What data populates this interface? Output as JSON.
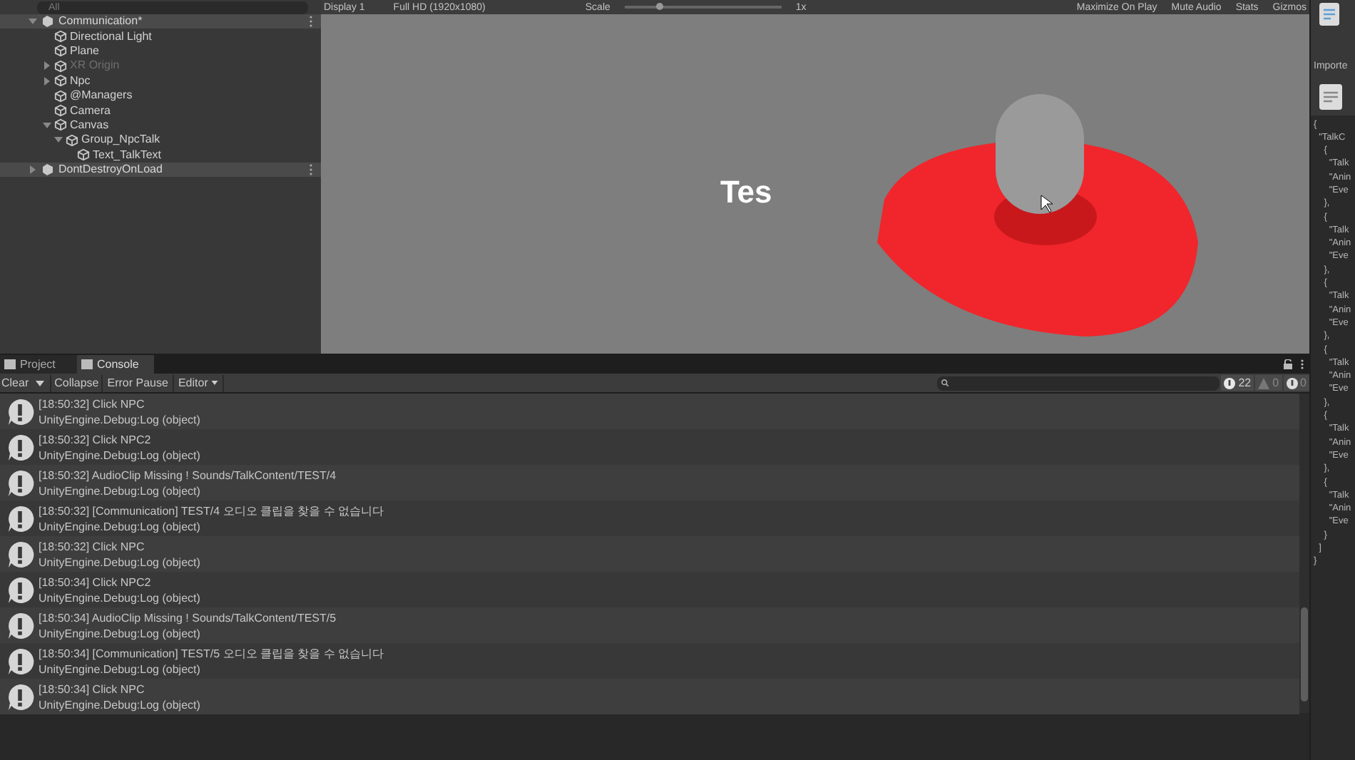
{
  "hierarchy": {
    "search": {
      "placeholder": "All"
    },
    "scenes": [
      {
        "name": "Communication*",
        "expanded": true,
        "children": [
          {
            "name": "Directional Light",
            "disabled": false
          },
          {
            "name": "Plane",
            "disabled": false
          },
          {
            "name": "XR Origin",
            "disabled": true,
            "expanded": false
          },
          {
            "name": "Npc",
            "disabled": false,
            "expanded": false
          },
          {
            "name": "@Managers",
            "disabled": false
          },
          {
            "name": "Camera",
            "disabled": false
          },
          {
            "name": "Canvas",
            "disabled": false,
            "expanded": true,
            "children": [
              {
                "name": "Group_NpcTalk",
                "disabled": false,
                "expanded": true,
                "children": [
                  {
                    "name": "Text_TalkText",
                    "disabled": false
                  }
                ]
              }
            ]
          }
        ]
      },
      {
        "name": "DontDestroyOnLoad",
        "expanded": false
      }
    ]
  },
  "game_toolbar": {
    "display": "Display 1",
    "resolution": "Full HD (1920x1080)",
    "scale_label": "Scale",
    "scale_slider": {
      "level": 0.2
    },
    "scale_value": "1x",
    "toggles": [
      "Maximize On Play",
      "Mute Audio",
      "Stats",
      "Gizmos"
    ]
  },
  "game_view": {
    "ui_text": "Tes"
  },
  "inspector": {
    "label": "Importe",
    "lines": [
      "{",
      "  \"TalkC",
      "    {",
      "      \"Talk",
      "      \"Anin",
      "      \"Eve",
      "    },",
      "    {",
      "      \"Talk",
      "      \"Anin",
      "      \"Eve",
      "    },",
      "    {",
      "      \"Talk",
      "      \"Anin",
      "      \"Eve",
      "    },",
      "    {",
      "      \"Talk",
      "      \"Anin",
      "      \"Eve",
      "    },",
      "    {",
      "      \"Talk",
      "      \"Anin",
      "      \"Eve",
      "    },",
      "    {",
      "      \"Talk",
      "      \"Anin",
      "      \"Eve",
      "    }",
      "  ]",
      "}"
    ]
  },
  "tabs": [
    {
      "label": "Project",
      "selected": false
    },
    {
      "label": "Console",
      "selected": true
    }
  ],
  "console_toolbar": {
    "clear": "Clear",
    "collapse": "Collapse",
    "error_pause": "Error Pause",
    "editor": "Editor",
    "counts": [
      {
        "kind": "info",
        "count": "22"
      },
      {
        "kind": "warning",
        "count": "0"
      },
      {
        "kind": "error",
        "count": "0"
      }
    ]
  },
  "console": [
    {
      "message": "[18:50:32] Click NPC",
      "trace": "UnityEngine.Debug:Log (object)"
    },
    {
      "message": "[18:50:32] Click NPC2",
      "trace": "UnityEngine.Debug:Log (object)"
    },
    {
      "message": "[18:50:32] AudioClip Missing ! Sounds/TalkContent/TEST/4",
      "trace": "UnityEngine.Debug:Log (object)"
    },
    {
      "message": "[18:50:32] [Communication] TEST/4 오디오 클립을 찾을 수 없습니다",
      "trace": "UnityEngine.Debug:Log (object)"
    },
    {
      "message": "[18:50:32] Click NPC",
      "trace": "UnityEngine.Debug:Log (object)"
    },
    {
      "message": "[18:50:34] Click NPC2",
      "trace": "UnityEngine.Debug:Log (object)"
    },
    {
      "message": "[18:50:34] AudioClip Missing ! Sounds/TalkContent/TEST/5",
      "trace": "UnityEngine.Debug:Log (object)"
    },
    {
      "message": "[18:50:34] [Communication] TEST/5 오디오 클립을 찾을 수 없습니다",
      "trace": "UnityEngine.Debug:Log (object)"
    },
    {
      "message": "[18:50:34] Click NPC",
      "trace": "UnityEngine.Debug:Log (object)"
    }
  ]
}
